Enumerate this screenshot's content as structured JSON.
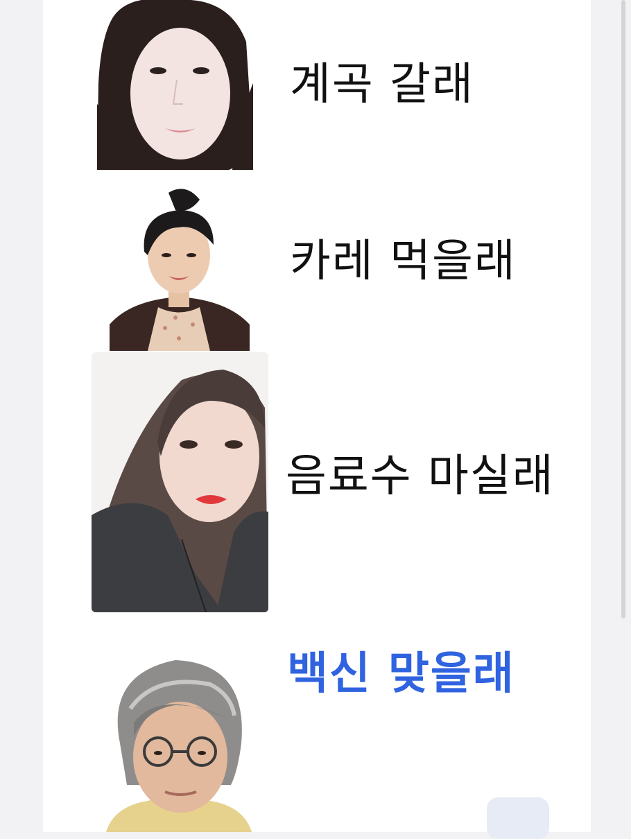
{
  "rows": [
    {
      "caption": "계곡 갈래",
      "photo_icon": "portrait-woman-long-hair"
    },
    {
      "caption": "카레 먹을래",
      "photo_icon": "portrait-woman-bun-hair"
    },
    {
      "caption": "음료수 마실래",
      "photo_icon": "portrait-woman-padded-jacket"
    },
    {
      "caption": "백신 맞을래",
      "photo_icon": "portrait-woman-gray-hair-glasses",
      "caption_color": "#2f63e0"
    }
  ]
}
